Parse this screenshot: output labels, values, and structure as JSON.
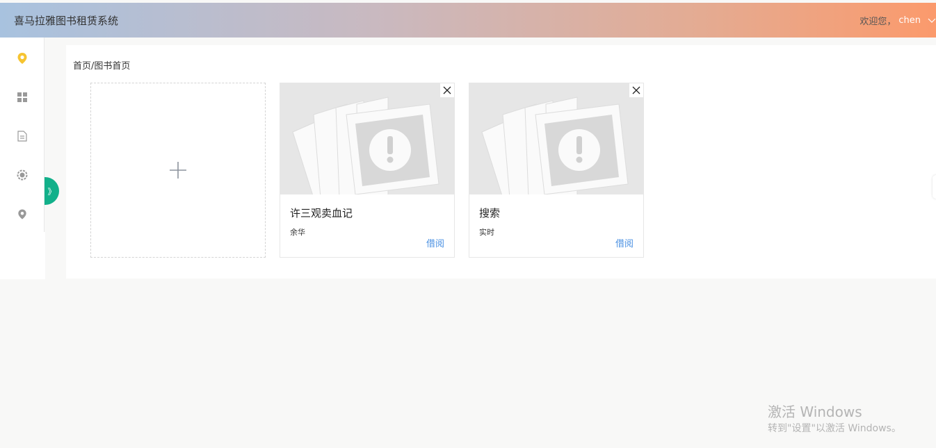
{
  "header": {
    "app_title": "喜马拉雅图书租赁系统",
    "welcome_text": "欢迎您，",
    "username": "chen",
    "user_menu_icon": "chevron-down-icon"
  },
  "sidebar": {
    "items": [
      {
        "icon": "location-pin-icon",
        "active": true
      },
      {
        "icon": "grid-icon",
        "active": false
      },
      {
        "icon": "document-icon",
        "active": false
      },
      {
        "icon": "settings-icon",
        "active": false
      },
      {
        "icon": "location-pin-icon",
        "active": false
      }
    ],
    "collapse_label": "》"
  },
  "breadcrumb": "首页/图书首页",
  "add_card": {
    "icon": "plus-icon"
  },
  "books": [
    {
      "title": "许三观卖血记",
      "author": "余华",
      "action": "借阅",
      "cover": "broken-image-icon"
    },
    {
      "title": "搜索",
      "author": "实时",
      "action": "借阅",
      "cover": "broken-image-icon"
    }
  ],
  "watermark": {
    "title": "激活 Windows",
    "subtitle": "转到\"设置\"以激活 Windows。"
  },
  "colors": {
    "accent_green": "#12b08a",
    "link_blue": "#4a90e2",
    "active_icon": "#f6c431",
    "header_gradient_start": "#a8c2df",
    "header_gradient_end": "#fb9a6c"
  }
}
